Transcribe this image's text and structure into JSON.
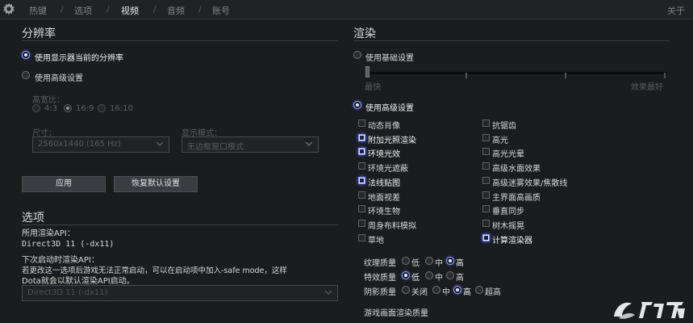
{
  "topbar": {
    "tabs": [
      {
        "label": "热键",
        "active": false
      },
      {
        "label": "选项",
        "active": false
      },
      {
        "label": "视频",
        "active": true
      },
      {
        "label": "音频",
        "active": false
      },
      {
        "label": "账号",
        "active": false
      }
    ],
    "separator": "/",
    "about": "关于"
  },
  "resolution": {
    "title": "分辨率",
    "use_monitor_label": "使用显示器当前的分辨率",
    "use_monitor_selected": true,
    "advanced_label": "使用高级设置",
    "aspect_label": "高宽比：",
    "aspect_options": [
      {
        "label": "4:3",
        "selected": false
      },
      {
        "label": "16:9",
        "selected": true
      },
      {
        "label": "16:10",
        "selected": false
      }
    ],
    "size_label": "尺寸：",
    "size_value": "2560x1440 (165 Hz)",
    "display_mode_label": "显示模式：",
    "display_mode_value": "无边框窗口模式"
  },
  "buttons": {
    "apply": "应用",
    "restore_defaults": "恢复默认设置"
  },
  "options": {
    "title": "选项",
    "api_label": "所用渲染API：",
    "api_value": "Direct3D 11 (-dx11)",
    "next_api_label": "下次启动时渲染API：",
    "note_line1": "若更改这一选项后游戏无法正常启动，可以在启动项中加入-safe mode，这样",
    "note_line2": "Dota就会以默认渲染API启动。",
    "api_dropdown_value": "Direct3D 11 (-dx11)"
  },
  "render": {
    "title": "渲染",
    "basic_label": "使用基础设置",
    "basic_selected": false,
    "slider_min_label": "最快",
    "slider_max_label": "效果最好",
    "advanced_label": "使用高级设置",
    "advanced_selected": true,
    "checkboxes_left": [
      {
        "label": "动态肖像",
        "checked": false
      },
      {
        "label": "附加光照渲染",
        "checked": true
      },
      {
        "label": "环境光效",
        "checked": true
      },
      {
        "label": "环境光遮蔽",
        "checked": false
      },
      {
        "label": "法线贴图",
        "checked": true
      },
      {
        "label": "地面视差",
        "checked": false
      },
      {
        "label": "环境生物",
        "checked": false
      },
      {
        "label": "周身布料模拟",
        "checked": false
      },
      {
        "label": "草地",
        "checked": false
      }
    ],
    "checkboxes_right": [
      {
        "label": "抗锯齿",
        "checked": false
      },
      {
        "label": "高光",
        "checked": false
      },
      {
        "label": "高光光晕",
        "checked": false
      },
      {
        "label": "高级水面效果",
        "checked": false
      },
      {
        "label": "高级迷雾效果/焦散线",
        "checked": false
      },
      {
        "label": "主界面高画质",
        "checked": false
      },
      {
        "label": "垂直同步",
        "checked": false
      },
      {
        "label": "树木摇晃",
        "checked": false
      },
      {
        "label": "计算渲染器",
        "checked": true
      }
    ],
    "texture_quality": {
      "label": "纹理质量",
      "options": [
        "低",
        "中",
        "高"
      ],
      "selected": "高"
    },
    "effects_quality": {
      "label": "特效质量",
      "options": [
        "低",
        "中",
        "高"
      ],
      "selected": "低"
    },
    "shadow_quality": {
      "label": "阴影质量",
      "options": [
        "关闭",
        "中",
        "高",
        "超高"
      ],
      "selected": "高"
    },
    "screen_quality_label": "游戏画面渲染质量"
  },
  "colors": {
    "accent": "#8aa0ff",
    "background": "#1b1c1e",
    "text": "#d6d9dc"
  }
}
